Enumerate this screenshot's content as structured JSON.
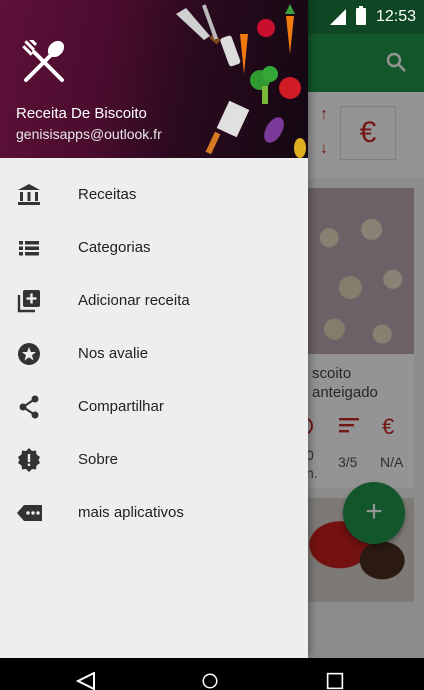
{
  "status_bar": {
    "time": "12:53"
  },
  "drawer": {
    "app_name": "Receita De Biscoito",
    "email": "genisisapps@outlook.fr",
    "items": [
      {
        "label": "Receitas",
        "icon": "bank-icon"
      },
      {
        "label": "Categorias",
        "icon": "list-icon"
      },
      {
        "label": "Adicionar receita",
        "icon": "add-box-icon"
      },
      {
        "label": "Nos avalie",
        "icon": "star-circle-icon"
      },
      {
        "label": "Compartilhar",
        "icon": "share-icon"
      },
      {
        "label": "Sobre",
        "icon": "info-badge-icon"
      },
      {
        "label": "mais aplicativos",
        "icon": "more-apps-icon"
      }
    ]
  },
  "background": {
    "sort_currency_symbol": "€",
    "card_title": "scoito\nanteigado",
    "card_values": [
      "0\nn.",
      "3/5",
      "N/A"
    ],
    "fab_label": "+"
  },
  "colors": {
    "accent": "#22944b",
    "header": "#4a0c2e",
    "red": "#c62828"
  }
}
